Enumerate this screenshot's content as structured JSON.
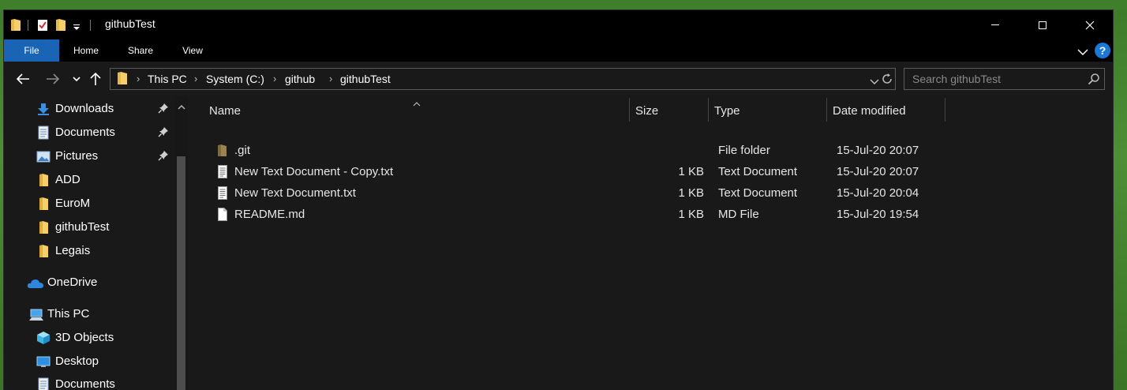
{
  "window": {
    "title": "githubTest"
  },
  "ribbon": {
    "tabs": [
      "File",
      "Home",
      "Share",
      "View"
    ]
  },
  "address": {
    "crumbs": [
      "This PC",
      "System (C:)",
      "github",
      "githubTest"
    ],
    "search_placeholder": "Search githubTest"
  },
  "nav": {
    "items": [
      {
        "label": "Downloads",
        "icon": "download-arrow-icon",
        "pinned": true
      },
      {
        "label": "Documents",
        "icon": "document-icon",
        "pinned": true
      },
      {
        "label": "Pictures",
        "icon": "pictures-icon",
        "pinned": true
      },
      {
        "label": "ADD",
        "icon": "folder-icon",
        "pinned": false
      },
      {
        "label": "EuroM",
        "icon": "folder-icon",
        "pinned": false
      },
      {
        "label": "githubTest",
        "icon": "folder-icon",
        "pinned": false
      },
      {
        "label": "Legais",
        "icon": "folder-icon",
        "pinned": false
      },
      {
        "label": "OneDrive",
        "icon": "onedrive-cloud-icon",
        "pinned": false
      },
      {
        "label": "This PC",
        "icon": "this-pc-icon",
        "pinned": false
      },
      {
        "label": "3D Objects",
        "icon": "3d-objects-icon",
        "pinned": false
      },
      {
        "label": "Desktop",
        "icon": "desktop-icon",
        "pinned": false
      },
      {
        "label": "Documents",
        "icon": "document-icon",
        "pinned": false
      }
    ]
  },
  "columns": {
    "name": "Name",
    "size": "Size",
    "type": "Type",
    "date": "Date modified"
  },
  "files": [
    {
      "name": ".git",
      "size": "",
      "type": "File folder",
      "date": "15-Jul-20 20:07",
      "icon": "folder-icon"
    },
    {
      "name": "New Text Document - Copy.txt",
      "size": "1 KB",
      "type": "Text Document",
      "date": "15-Jul-20 20:07",
      "icon": "text-file-icon"
    },
    {
      "name": "New Text Document.txt",
      "size": "1 KB",
      "type": "Text Document",
      "date": "15-Jul-20 20:04",
      "icon": "text-file-icon"
    },
    {
      "name": "README.md",
      "size": "1 KB",
      "type": "MD File",
      "date": "15-Jul-20 19:54",
      "icon": "blank-file-icon"
    }
  ],
  "colors": {
    "file_tab": "#1a64b5",
    "window_bg": "#191919",
    "titlebar_bg": "#000000",
    "folder_yellow": "#e8b84a",
    "help_blue": "#1a78d6"
  }
}
